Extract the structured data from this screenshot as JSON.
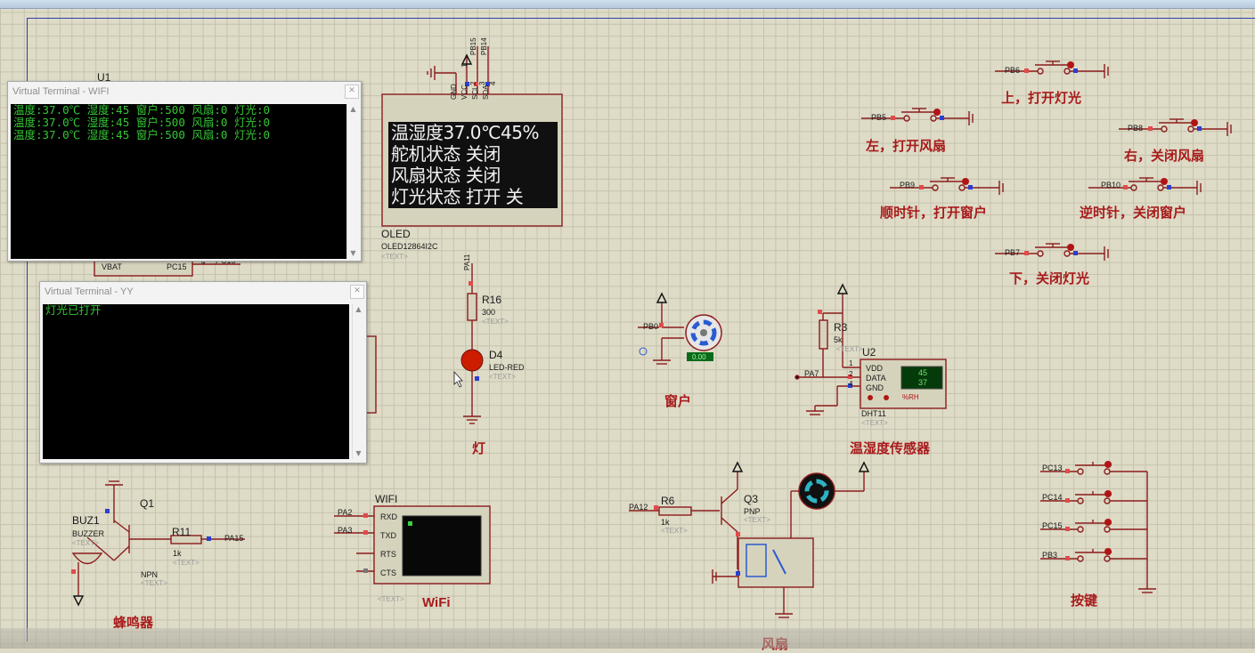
{
  "terminal_wifi": {
    "title": "Virtual Terminal - WIFI",
    "lines": [
      "温度:37.0℃ 湿度:45 窗户:500 风扇:0 灯光:0",
      "温度:37.0℃ 湿度:45 窗户:500 风扇:0 灯光:0",
      "温度:37.0℃ 湿度:45 窗户:500 风扇:0 灯光:0"
    ]
  },
  "terminal_yy": {
    "title": "Virtual Terminal - YY",
    "lines": [
      "灯光已打开"
    ]
  },
  "oled": {
    "name": "OLED",
    "part": "OLED12864I2C",
    "text_placeholder": "<TEXT>",
    "lines": [
      "温湿度37.0℃45%",
      "舵机状态 关闭",
      "风扇状态 关闭",
      "灯光状态 打开 关"
    ],
    "pins": [
      "GND",
      "VCC",
      "SCL",
      "SDA"
    ],
    "pin_numbers": [
      "1",
      "2",
      "3",
      "4"
    ],
    "net_labels": [
      "PB15",
      "PB14"
    ]
  },
  "buttons_right": [
    {
      "net": "PB6",
      "label": "上，打开灯光"
    },
    {
      "net": "PB5",
      "label": "左，打开风扇"
    },
    {
      "net": "PB8",
      "label": "右，关闭风扇"
    },
    {
      "net": "PB9",
      "label": "顺时针，打开窗户"
    },
    {
      "net": "PB10",
      "label": "逆时针，关闭窗户"
    },
    {
      "net": "PB7",
      "label": "下，关闭灯光"
    }
  ],
  "led_section": {
    "net": "PA11",
    "resistor": "R16",
    "resistor_value": "300",
    "led": "D4",
    "led_part": "LED-RED",
    "caption": "灯"
  },
  "window_section": {
    "net": "PB0",
    "readout": "0.00",
    "caption": "窗户"
  },
  "sensor_section": {
    "resistor": "R3",
    "resistor_value": "5k",
    "chip": "U2",
    "part": "DHT11",
    "net": "PA7",
    "pins": [
      "VDD",
      "DATA",
      "GND"
    ],
    "pin_numbers": [
      "1",
      "2",
      "4"
    ],
    "humidity": "45",
    "temperature": "37",
    "unit": "%RH",
    "caption": "温湿度传感器"
  },
  "fan_section": {
    "net": "PA12",
    "resistor": "R6",
    "resistor_value": "1k",
    "transistor": "Q3",
    "transistor_type": "PNP",
    "caption": "风扇"
  },
  "keys_section": {
    "nets": [
      "PC13",
      "PC14",
      "PC15",
      "PB3"
    ],
    "caption": "按键"
  },
  "buzzer_section": {
    "buzzer": "BUZ1",
    "buzzer_part": "BUZZER",
    "transistor": "Q1",
    "transistor_type": "NPN",
    "resistor": "R11",
    "resistor_value": "1k",
    "net": "PA15",
    "caption": "蜂鸣器"
  },
  "wifi_section": {
    "name": "WIFI",
    "nets": [
      "PA2",
      "PA3"
    ],
    "pins": [
      "RXD",
      "TXD",
      "RTS",
      "CTS"
    ],
    "caption": "WiFi"
  },
  "mcu_fragment": {
    "left_pin": "VBAT",
    "right_pin": "PC15",
    "pin_number": "4",
    "net": "PC15",
    "top_label": "U1"
  },
  "colors": {
    "sheet": "#dedbc7",
    "wire": "#8b1c1c",
    "label_red": "#a81b1b",
    "terminal_text": "#35c635",
    "led": "#cc1d00"
  }
}
